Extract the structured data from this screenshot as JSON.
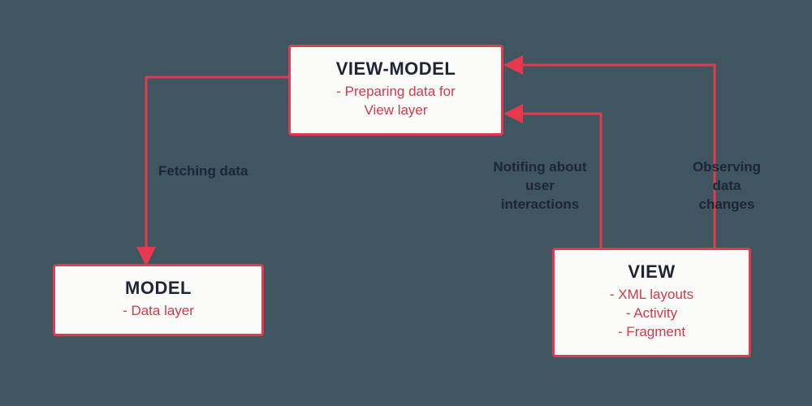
{
  "diagram": {
    "nodes": {
      "viewmodel": {
        "title": "VIEW-MODEL",
        "desc": "- Preparing data for\nView layer"
      },
      "model": {
        "title": "MODEL",
        "desc": "- Data layer"
      },
      "view": {
        "title": "VIEW",
        "desc": "- XML layouts\n- Activity\n- Fragment"
      }
    },
    "edges": {
      "fetching": {
        "label": "Fetching data"
      },
      "notifying": {
        "label": "Notifing about\nuser\ninteractions"
      },
      "observing": {
        "label": "Observing\ndata\nchanges"
      }
    },
    "colors": {
      "background": "#3f5560",
      "boxFill": "#fbfbf9",
      "accent": "#e63950",
      "titleText": "#1e2536",
      "descText": "#cf3a4b"
    }
  }
}
